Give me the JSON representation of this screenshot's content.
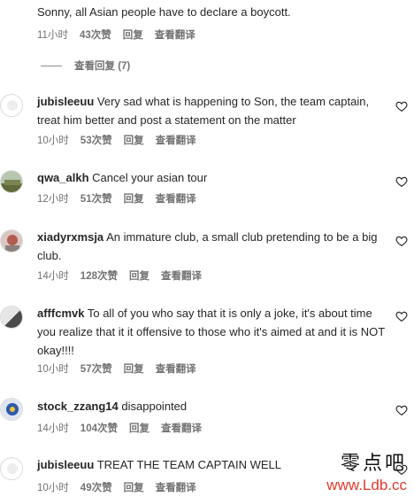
{
  "comments": [
    {
      "text": "Sonny, all Asian people have to declare a boycott.",
      "time": "11小时",
      "likes": "43次赞",
      "reply": "回复",
      "translate": "查看翻译",
      "view_replies": "查看回复 (7)"
    },
    {
      "username": "jubisleeuu",
      "text": "Very sad what is happening to Son, the team captain, treat him better and post a statement on the matter",
      "time": "10小时",
      "likes": "53次赞",
      "reply": "回复",
      "translate": "查看翻译"
    },
    {
      "username": "qwa_alkh",
      "text": "Cancel your asian tour",
      "time": "12小时",
      "likes": "51次赞",
      "reply": "回复",
      "translate": "查看翻译"
    },
    {
      "username": "xiadyrxmsja",
      "text": "An immature club, a small club pretending to be a big club.",
      "time": "14小时",
      "likes": "128次赞",
      "reply": "回复",
      "translate": "查看翻译"
    },
    {
      "username": "afffcmvk",
      "text": "To all of you who say that it is only a joke, it's about time you realize that it it offensive to those who it's aimed at and it is NOT okay!!!!",
      "time": "10小时",
      "likes": "57次赞",
      "reply": "回复",
      "translate": "查看翻译"
    },
    {
      "username": "stock_zzang14",
      "text": "disappointed",
      "time": "14小时",
      "likes": "104次赞",
      "reply": "回复",
      "translate": "查看翻译"
    },
    {
      "username": "jubisleeuu",
      "text": "TREAT THE TEAM CAPTAIN WELL",
      "time": "10小时",
      "likes": "49次赞",
      "reply": "回复",
      "translate": "查看翻译"
    }
  ],
  "watermark": {
    "chinese": "零点吧",
    "url": "www.Ldb.cc"
  },
  "icons": {
    "like": "heart-outline-icon",
    "avatar_default": "default-avatar-icon"
  },
  "colors": {
    "text": "#262626",
    "meta": "#737373",
    "watermark_url": "#e03a2b"
  }
}
